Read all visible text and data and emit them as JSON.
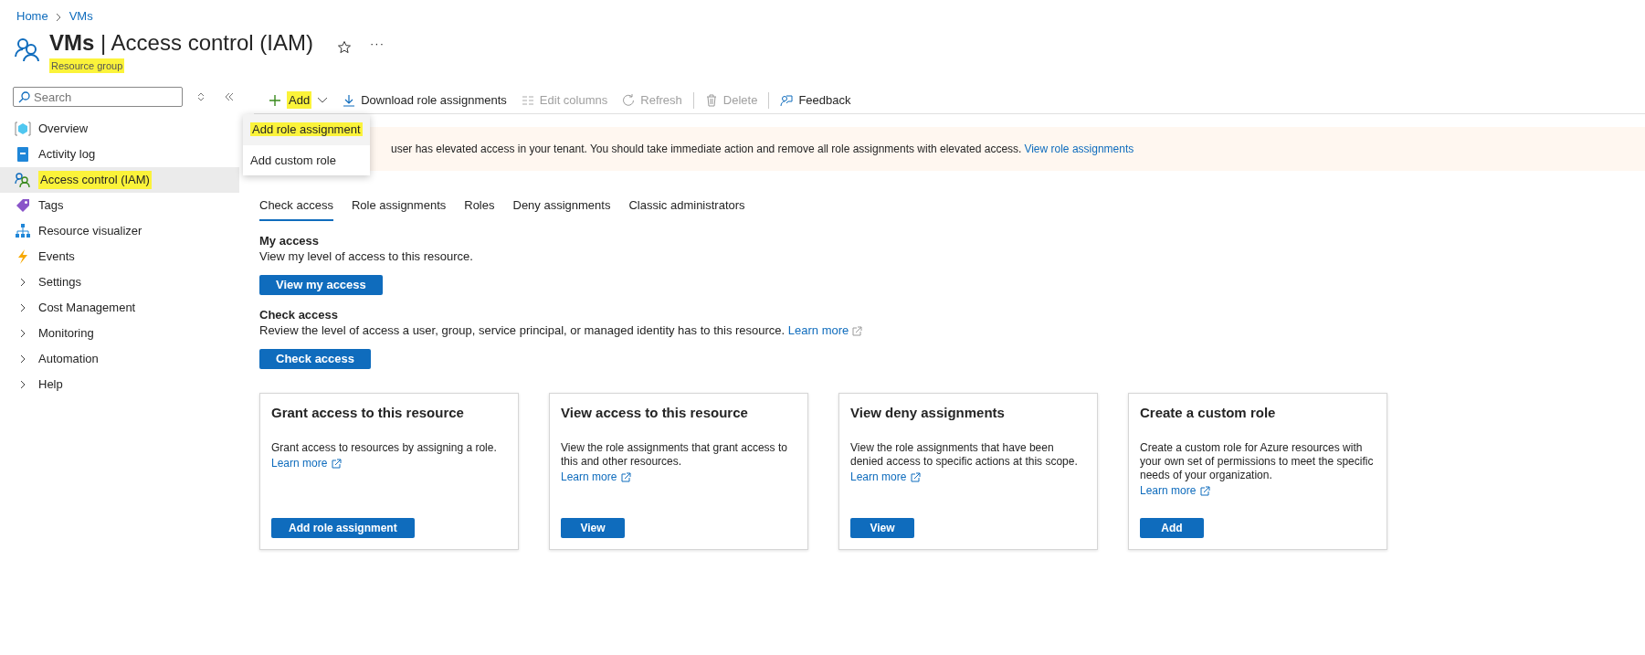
{
  "breadcrumb": [
    {
      "label": "Home"
    },
    {
      "label": "VMs"
    }
  ],
  "header": {
    "title_bold": "VMs",
    "title_rest": "| Access control (IAM)",
    "subtitle": "Resource group",
    "subtitle_highlighted": true,
    "favorite": false,
    "more": "···"
  },
  "sidebar": {
    "search": {
      "placeholder": "Search"
    },
    "items": [
      {
        "label": "Overview",
        "kind": "overview",
        "selected": false,
        "highlighted": false
      },
      {
        "label": "Activity log",
        "kind": "log",
        "selected": false,
        "highlighted": false
      },
      {
        "label": "Access control (IAM)",
        "kind": "iam",
        "selected": true,
        "highlighted": true
      },
      {
        "label": "Tags",
        "kind": "tag",
        "selected": false,
        "highlighted": false
      },
      {
        "label": "Resource visualizer",
        "kind": "visualizer",
        "selected": false,
        "highlighted": false
      },
      {
        "label": "Events",
        "kind": "events",
        "selected": false,
        "highlighted": false
      },
      {
        "label": "Settings",
        "kind": "group",
        "selected": false,
        "highlighted": false,
        "expanded": false
      },
      {
        "label": "Cost Management",
        "kind": "group",
        "selected": false,
        "highlighted": false,
        "expanded": false
      },
      {
        "label": "Monitoring",
        "kind": "group",
        "selected": false,
        "highlighted": false,
        "expanded": false
      },
      {
        "label": "Automation",
        "kind": "group",
        "selected": false,
        "highlighted": false,
        "expanded": false
      },
      {
        "label": "Help",
        "kind": "group",
        "selected": false,
        "highlighted": false,
        "expanded": false
      }
    ]
  },
  "toolbar": [
    {
      "label": "Add",
      "kind": "add",
      "disabled": false,
      "highlighted": true,
      "expanded": true
    },
    {
      "label": "Download role assignments",
      "kind": "download",
      "disabled": false,
      "highlighted": false
    },
    {
      "label": "Edit columns",
      "kind": "columns",
      "disabled": true,
      "highlighted": false
    },
    {
      "label": "Refresh",
      "kind": "refresh",
      "disabled": true,
      "highlighted": false
    },
    {
      "label": "Delete",
      "kind": "delete",
      "disabled": true,
      "highlighted": false
    },
    {
      "label": "Feedback",
      "kind": "feedback",
      "disabled": false,
      "highlighted": false
    }
  ],
  "add_menu": [
    {
      "label": "Add role assignment",
      "highlighted": true,
      "selected": true
    },
    {
      "label": "Add custom role",
      "highlighted": false,
      "selected": false
    }
  ],
  "banner": {
    "message": "user has elevated access in your tenant. You should take immediate action and remove all role assignments with elevated access.",
    "link": "View role assignments"
  },
  "tabs": [
    {
      "label": "Check access",
      "selected": true
    },
    {
      "label": "Role assignments",
      "selected": false
    },
    {
      "label": "Roles",
      "selected": false
    },
    {
      "label": "Deny assignments",
      "selected": false
    },
    {
      "label": "Classic administrators",
      "selected": false
    }
  ],
  "sections": [
    {
      "heading": "My access",
      "text": "View my level of access to this resource.",
      "button": "View my access"
    },
    {
      "heading": "Check access",
      "text": "Review the level of access a user, group, service principal, or managed identity has to this resource.",
      "link": "Learn more",
      "button": "Check access"
    }
  ],
  "cards": [
    {
      "title": "Grant access to this resource",
      "text": "Grant access to resources by assigning a role.",
      "link": "Learn more",
      "button": "Add role assignment"
    },
    {
      "title": "View access to this resource",
      "text": "View the role assignments that grant access to this and other resources.",
      "link": "Learn more",
      "button": "View"
    },
    {
      "title": "View deny assignments",
      "text": "View the role assignments that have been denied access to specific actions at this scope.",
      "link": "Learn more",
      "button": "View"
    },
    {
      "title": "Create a custom role",
      "text": "Create a custom role for Azure resources with your own set of permissions to meet the specific needs of your organization.",
      "link": "Learn more",
      "button": "Add"
    }
  ]
}
